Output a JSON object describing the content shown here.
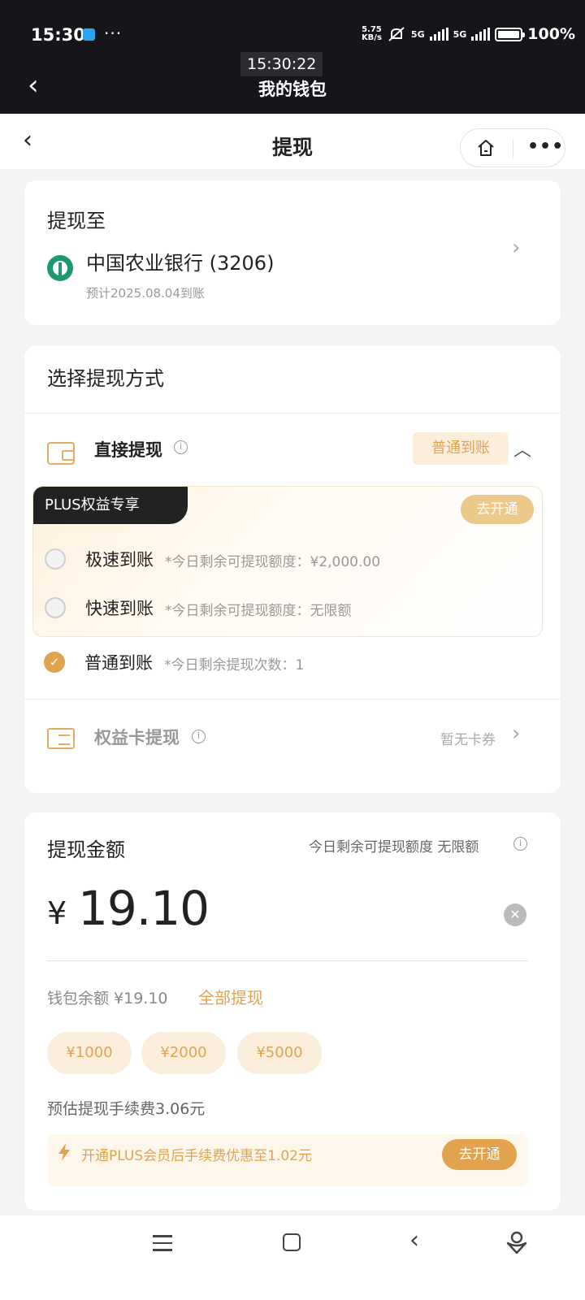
{
  "status_bar": {
    "time": "15:30",
    "net_speed_value": "5.75",
    "net_speed_unit": "KB/s",
    "signal1_label": "5G",
    "signal2_label": "5G",
    "battery": "100%"
  },
  "topbar": {
    "title": "我的钱包",
    "time_overlay": "15:30:22"
  },
  "navbar": {
    "title": "提现",
    "more_label": "•••"
  },
  "destination": {
    "label": "提现至",
    "bank_name": "中国农业银行 (3206)",
    "eta": "预计2025.08.04到账"
  },
  "method": {
    "section_title": "选择提现方式",
    "direct_title": "直接提现",
    "direct_badge": "普通到账",
    "plus_tag": "PLUS权益专享",
    "plus_open": "去开通",
    "options": [
      {
        "title": "极速到账",
        "note": "*今日剩余可提现额度：¥2,000.00",
        "selected": false
      },
      {
        "title": "快速到账",
        "note": "*今日剩余可提现额度：无限额",
        "selected": false
      },
      {
        "title": "普通到账",
        "note": "*今日剩余提现次数：1",
        "selected": true
      }
    ],
    "card_title": "权益卡提现",
    "card_status": "暂无卡券"
  },
  "amount": {
    "label": "提现金额",
    "limit_hint": "今日剩余可提现额度 无限额",
    "currency": "¥",
    "value": "19.10",
    "balance_label": "钱包余额 ¥19.10",
    "withdraw_all": "全部提现",
    "quick_amounts": [
      "¥1000",
      "¥2000",
      "¥5000"
    ],
    "fee": "预估提现手续费3.06元",
    "promo_text": "开通PLUS会员后手续费优惠至1.02元",
    "promo_button": "去开通"
  },
  "colors": {
    "accent": "#e2a34f",
    "dark_header": "#15151a",
    "bank_green": "#1c9a6e"
  }
}
